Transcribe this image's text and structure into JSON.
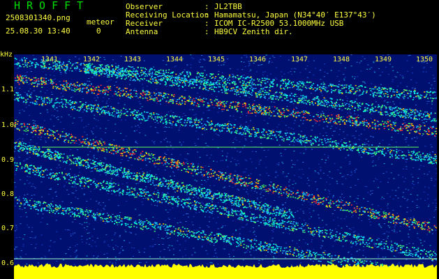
{
  "header": {
    "app_title": "HROFFT",
    "filename": "2508301340.png",
    "datetime": "25.08.30 13:40",
    "meteor_label": "meteor",
    "meteor_count": "0",
    "info": [
      {
        "label": "Observer",
        "value": "JL2TBB"
      },
      {
        "label": "Receiving Location",
        "value": "Hamamatsu, Japan (N34°40′ E137°43′)"
      },
      {
        "label": "Receiver",
        "value": "ICOM IC-R2500 53.1000MHz USB"
      },
      {
        "label": "Antenna",
        "value": "HB9CV Zenith dir."
      }
    ]
  },
  "axis": {
    "y_unit": "kHz",
    "x_ticks": [
      "1341",
      "1342",
      "1343",
      "1344",
      "1345",
      "1346",
      "1347",
      "1348",
      "1349",
      "1350"
    ],
    "y_ticks": [
      "1.1",
      "1.0",
      "0.9",
      "0.8",
      "0.7",
      "0.6"
    ]
  },
  "colors": {
    "title": "#00e000",
    "text": "#ffff40",
    "background": "#001070",
    "grid_line": "#60ff60",
    "noise": "#ffff00"
  }
}
